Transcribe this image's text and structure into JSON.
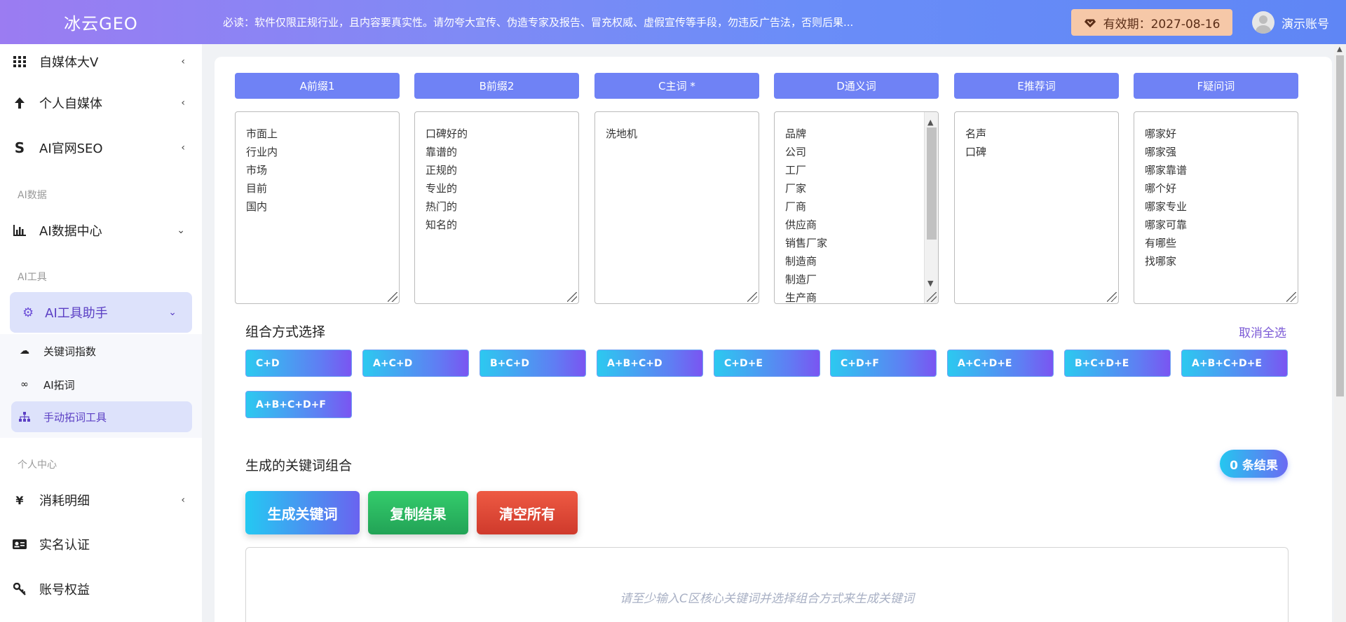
{
  "header": {
    "logo": "冰云GEO",
    "notice": "必读：软件仅限正规行业，且内容要真实性。请勿夸大宣传、伪造专家及报告、冒充权威、虚假宣传等手段，勿违反广告法，否则后果...",
    "validity": "有效期：2027-08-16",
    "account": "演示账号"
  },
  "sidebar": {
    "items_top": [
      {
        "icon": "grid-icon",
        "label": "自媒体大V"
      },
      {
        "icon": "arrow-up-icon",
        "label": "个人自媒体"
      },
      {
        "icon": "s-logo-icon",
        "label": "AI官网SEO"
      }
    ],
    "section_data": "AI数据",
    "data_center": "AI数据中心",
    "section_tools": "AI工具",
    "tools_helper": "AI工具助手",
    "sub_items": [
      "关键词指数",
      "AI拓词",
      "手动拓词工具"
    ],
    "section_personal": "个人中心",
    "items_bottom": [
      "消耗明细",
      "实名认证",
      "账号权益"
    ]
  },
  "columns": [
    {
      "header": "A前缀1",
      "lines": [
        "市面上",
        "行业内",
        "市场",
        "目前",
        "国内"
      ]
    },
    {
      "header": "B前缀2",
      "lines": [
        "口碑好的",
        "靠谱的",
        "正规的",
        "专业的",
        "热门的",
        "知名的"
      ]
    },
    {
      "header": "C主词 *",
      "lines": [
        "洗地机"
      ]
    },
    {
      "header": "D通义词",
      "lines": [
        "品牌",
        "公司",
        "工厂",
        "厂家",
        "厂商",
        "供应商",
        "销售厂家",
        "制造商",
        "制造厂",
        "生产商"
      ]
    },
    {
      "header": "E推荐词",
      "lines": [
        "名声",
        "口碑"
      ]
    },
    {
      "header": "F疑问词",
      "lines": [
        "哪家好",
        "哪家强",
        "哪家靠谱",
        "哪个好",
        "哪家专业",
        "哪家可靠",
        "有哪些",
        "找哪家"
      ]
    }
  ],
  "combo_section": {
    "title": "组合方式选择",
    "cancel_all": "取消全选",
    "options": [
      "C+D",
      "A+C+D",
      "B+C+D",
      "A+B+C+D",
      "C+D+E",
      "C+D+F",
      "A+C+D+E",
      "B+C+D+E",
      "A+B+C+D+E",
      "A+B+C+D+F"
    ]
  },
  "results": {
    "title": "生成的关键词组合",
    "count_badge": "0 条结果",
    "generate": "生成关键词",
    "copy": "复制结果",
    "clear": "清空所有",
    "placeholder": "请至少输入C区核心关键词并选择组合方式来生成关键词"
  },
  "colors": {
    "accent": "#6f82f5",
    "active_nav": "#5b3fc4",
    "copy_green": "#2bb860",
    "clear_red": "#e0473a"
  }
}
